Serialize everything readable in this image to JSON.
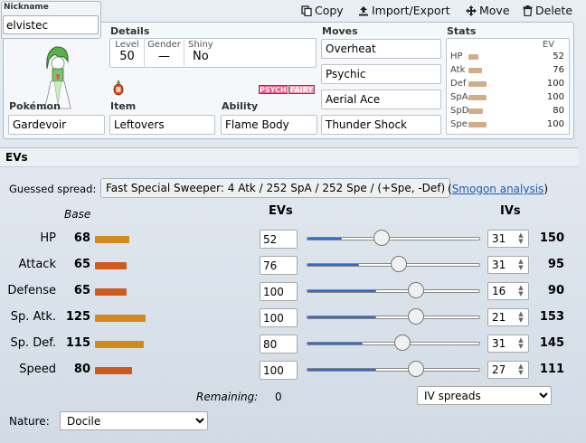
{
  "toolbar": {
    "copy": "Copy",
    "import_export": "Import/Export",
    "move": "Move",
    "delete": "Delete"
  },
  "set": {
    "nickname_label": "Nickname",
    "nickname": "elvistec",
    "details_label": "Details",
    "level_label": "Level",
    "level": "50",
    "gender_label": "Gender",
    "gender": "—",
    "shiny_label": "Shiny",
    "shiny": "No",
    "types": [
      "PSYCHIC",
      "FAIRY"
    ],
    "pokemon_label": "Pokémon",
    "pokemon": "Gardevoir",
    "item_label": "Item",
    "item": "Leftovers",
    "ability_label": "Ability",
    "ability": "Flame Body",
    "moves_label": "Moves",
    "moves": [
      "Overheat",
      "Psychic",
      "Aerial Ace",
      "Thunder Shock"
    ],
    "stats_label": "Stats",
    "stats_ev_header": "EV",
    "stats": [
      {
        "label": "HP",
        "value": "52",
        "fill": 0.21
      },
      {
        "label": "Atk",
        "value": "76",
        "fill": 0.3
      },
      {
        "label": "Def",
        "value": "100",
        "fill": 0.4
      },
      {
        "label": "SpA",
        "value": "100",
        "fill": 0.4
      },
      {
        "label": "SpD",
        "value": "80",
        "fill": 0.32
      },
      {
        "label": "Spe",
        "value": "100",
        "fill": 0.4
      }
    ]
  },
  "evs": {
    "title": "EVs",
    "guessed_label": "Guessed spread:",
    "guessed_value": "Fast Special Sweeper: 4 Atk / 252 SpA / 252 Spe / (+Spe, -Def)",
    "smogon_open": "(",
    "smogon_link": "Smogon analysis",
    "smogon_close": ")",
    "base_header": "Base",
    "evs_header": "EVs",
    "ivs_header": "IVs",
    "rows": [
      {
        "name": "HP",
        "base": "68",
        "base_fill": 0.3,
        "ev": "52",
        "ev_fill": 0.2,
        "iv": "31",
        "total": "150",
        "bar_color": "#d08a1e"
      },
      {
        "name": "Attack",
        "base": "65",
        "base_fill": 0.28,
        "ev": "76",
        "ev_fill": 0.3,
        "iv": "31",
        "total": "95",
        "bar_color": "#d05a1e"
      },
      {
        "name": "Defense",
        "base": "65",
        "base_fill": 0.28,
        "ev": "100",
        "ev_fill": 0.4,
        "iv": "16",
        "total": "90",
        "bar_color": "#d05a1e"
      },
      {
        "name": "Sp. Atk.",
        "base": "125",
        "base_fill": 0.45,
        "ev": "100",
        "ev_fill": 0.4,
        "iv": "21",
        "total": "153",
        "bar_color": "#d08a1e"
      },
      {
        "name": "Sp. Def.",
        "base": "115",
        "base_fill": 0.43,
        "ev": "80",
        "ev_fill": 0.32,
        "iv": "31",
        "total": "145",
        "bar_color": "#d08a1e"
      },
      {
        "name": "Speed",
        "base": "80",
        "base_fill": 0.33,
        "ev": "100",
        "ev_fill": 0.4,
        "iv": "27",
        "total": "111",
        "bar_color": "#d05a1e"
      }
    ],
    "remaining_label": "Remaining:",
    "remaining_value": "0",
    "iv_spreads": "IV spreads",
    "nature_label": "Nature:",
    "nature": "Docile"
  },
  "colors": {
    "psychic": "#f85888",
    "fairy": "#ee99ac",
    "link": "#1a5fb4",
    "slider_fill": "#2d6bd1"
  }
}
